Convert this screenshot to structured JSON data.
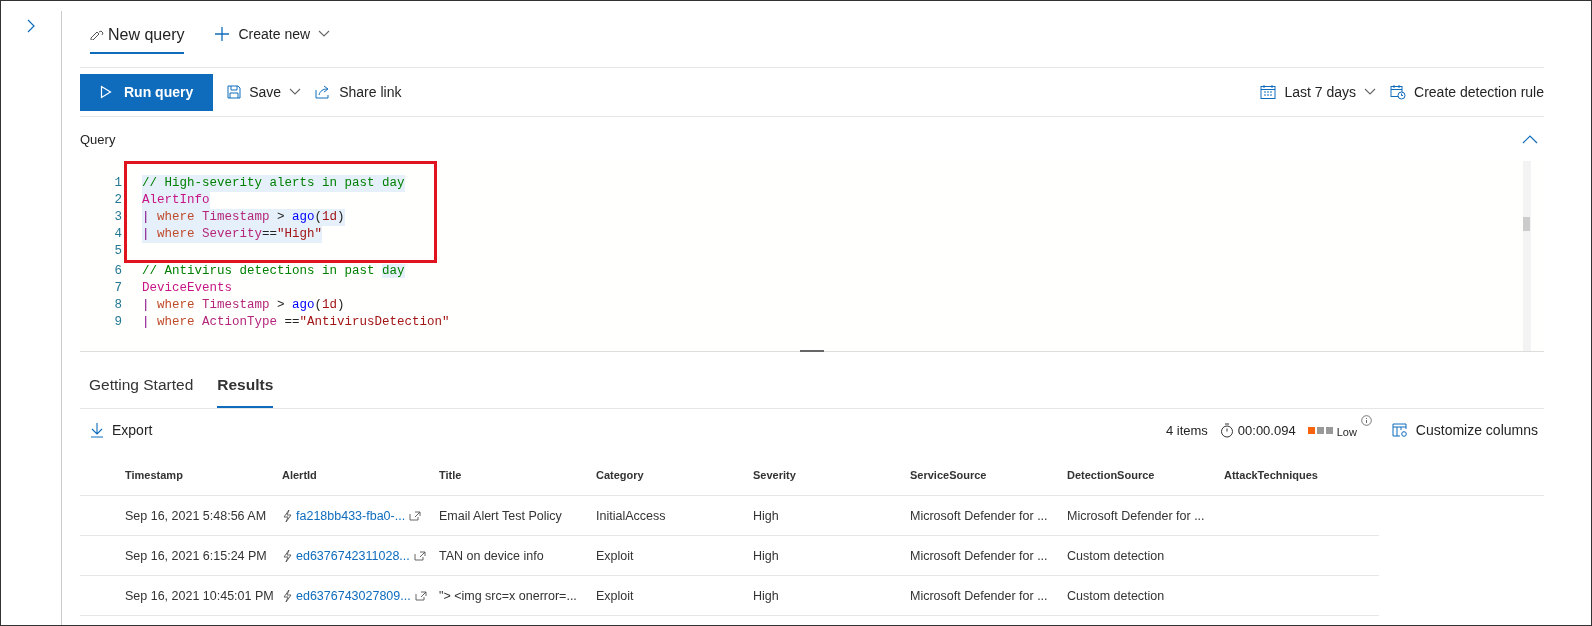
{
  "tabs": [
    {
      "label": "New query",
      "selected": true
    }
  ],
  "create_new": {
    "label": "Create new"
  },
  "toolbar": {
    "run": "Run query",
    "save": "Save",
    "share": "Share link",
    "range": "Last 7 days",
    "detection": "Create detection rule"
  },
  "query": {
    "label": "Query",
    "expanded": true,
    "lines": [
      {
        "number": "1",
        "selected": true,
        "boxed": true,
        "tokens": [
          {
            "kind": "comment",
            "text": "// High-severity alerts in past day"
          }
        ]
      },
      {
        "number": "2",
        "selected": true,
        "boxed": true,
        "tokens": [
          {
            "kind": "table",
            "text": "AlertInfo"
          }
        ]
      },
      {
        "number": "3",
        "selected": true,
        "boxed": true,
        "tokens": [
          {
            "kind": "pipe",
            "text": "| "
          },
          {
            "kind": "keyword",
            "text": "where "
          },
          {
            "kind": "column",
            "text": "Timestamp"
          },
          {
            "kind": "plain",
            "text": " > "
          },
          {
            "kind": "function",
            "text": "ago"
          },
          {
            "kind": "plain",
            "text": "("
          },
          {
            "kind": "literal",
            "text": "1d"
          },
          {
            "kind": "plain",
            "text": ")"
          }
        ]
      },
      {
        "number": "4",
        "selected": true,
        "boxed": true,
        "tokens": [
          {
            "kind": "pipe",
            "text": "| "
          },
          {
            "kind": "keyword",
            "text": "where "
          },
          {
            "kind": "column",
            "text": "Severity"
          },
          {
            "kind": "plain",
            "text": "=="
          },
          {
            "kind": "string",
            "text": "\"High\""
          }
        ]
      },
      {
        "number": "5",
        "selected": false,
        "boxed": true
      },
      {
        "number": "6",
        "selected": false,
        "boxed": false,
        "tokens": [
          {
            "kind": "comment",
            "text": "// Antivirus detections in past "
          },
          {
            "kind": "comment",
            "text": "day",
            "highlighted": true
          }
        ]
      },
      {
        "number": "7",
        "selected": false,
        "boxed": false,
        "tokens": [
          {
            "kind": "table",
            "text": "DeviceEvents"
          }
        ]
      },
      {
        "number": "8",
        "selected": false,
        "boxed": false,
        "tokens": [
          {
            "kind": "pipe",
            "text": "| "
          },
          {
            "kind": "keyword",
            "text": "where "
          },
          {
            "kind": "column",
            "text": "Timestamp"
          },
          {
            "kind": "plain",
            "text": " > "
          },
          {
            "kind": "function",
            "text": "ago"
          },
          {
            "kind": "plain",
            "text": "("
          },
          {
            "kind": "literal",
            "text": "1d"
          },
          {
            "kind": "plain",
            "text": ")"
          }
        ]
      },
      {
        "number": "9",
        "selected": false,
        "boxed": false,
        "tokens": [
          {
            "kind": "pipe",
            "text": "| "
          },
          {
            "kind": "keyword",
            "text": "where "
          },
          {
            "kind": "column",
            "text": "ActionType"
          },
          {
            "kind": "plain",
            "text": " =="
          },
          {
            "kind": "string",
            "text": "\"AntivirusDetection\""
          }
        ]
      }
    ]
  },
  "result_tabs": [
    {
      "label": "Getting Started",
      "selected": false
    },
    {
      "label": "Results",
      "selected": true
    }
  ],
  "results_bar": {
    "export": "Export",
    "count": "4 items",
    "duration": "00:00.094",
    "usage": {
      "label": "Low",
      "level": 0.33
    },
    "customize": "Customize columns"
  },
  "table": {
    "columns": [
      "Timestamp",
      "AlertId",
      "Title",
      "Category",
      "Severity",
      "ServiceSource",
      "DetectionSource",
      "AttackTechniques"
    ],
    "rows": [
      [
        "Sep 16, 2021 5:48:56 AM",
        "fa218bb433-fba0-...",
        "Email Alert Test Policy",
        "InitialAccess",
        "High",
        "Microsoft Defender for ...",
        "Microsoft Defender for ..."
      ],
      [
        "Sep 16, 2021 6:15:24 PM",
        "ed6376742311028...",
        "TAN on device info",
        "Exploit",
        "High",
        "Microsoft Defender for ...",
        "Custom detection"
      ],
      [
        "Sep 16, 2021 10:45:01 PM",
        "ed6376743027809...",
        "\"> <img src=x onerror=...",
        "Exploit",
        "High",
        "Microsoft Defender for ...",
        "Custom detection"
      ]
    ]
  }
}
